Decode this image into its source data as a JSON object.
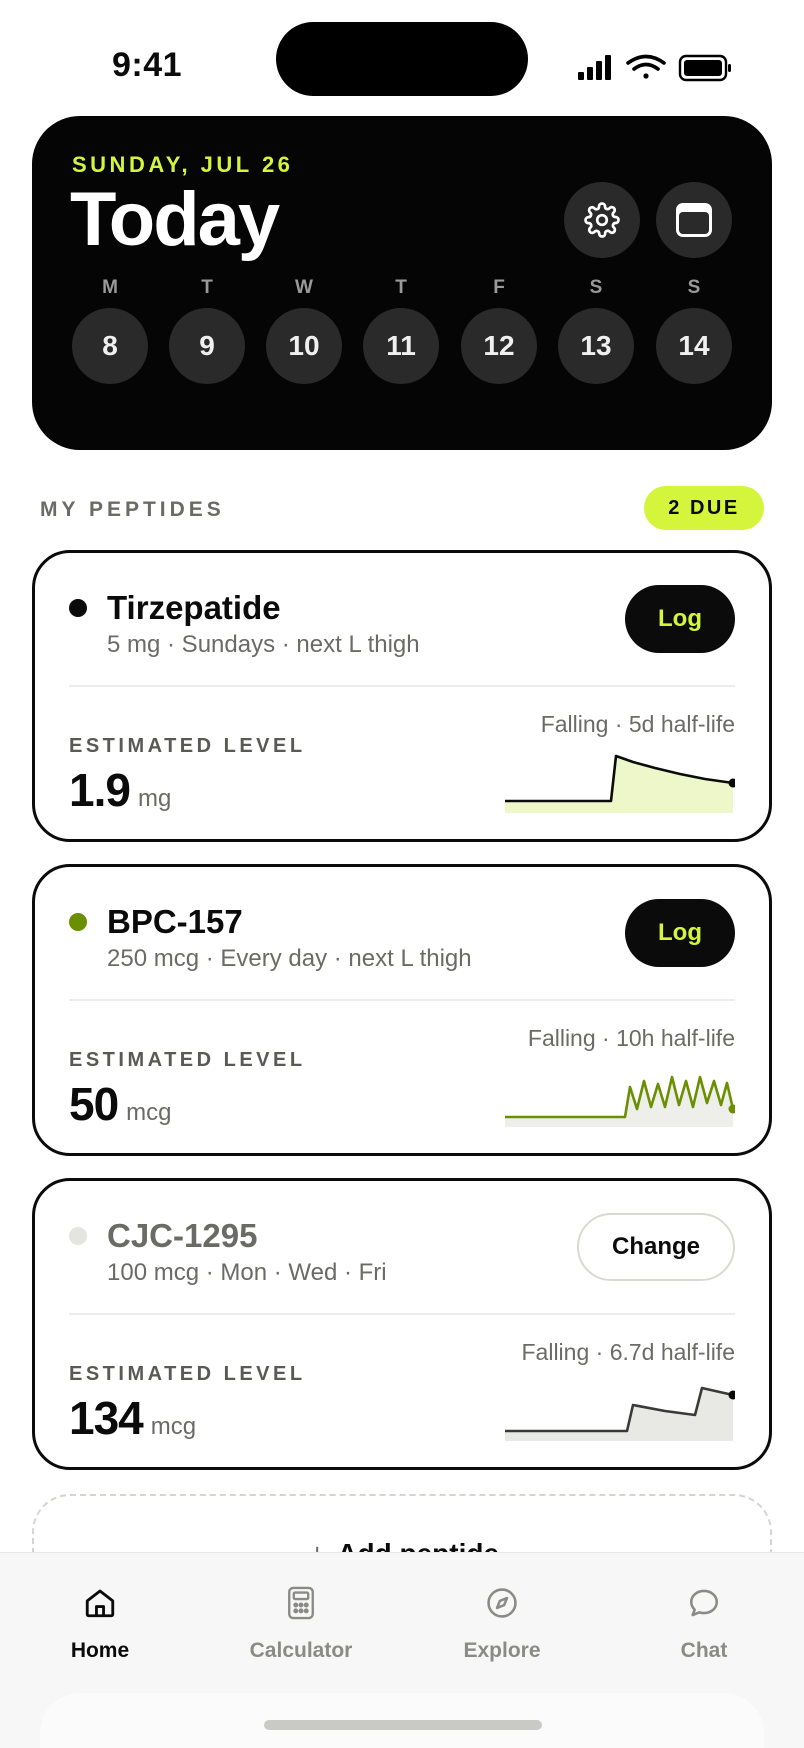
{
  "status_bar": {
    "time": "9:41"
  },
  "hero": {
    "date": "SUNDAY, JUL 26",
    "title": "Today",
    "week": [
      {
        "letter": "M",
        "day": "8"
      },
      {
        "letter": "T",
        "day": "9"
      },
      {
        "letter": "W",
        "day": "10"
      },
      {
        "letter": "T",
        "day": "11"
      },
      {
        "letter": "F",
        "day": "12"
      },
      {
        "letter": "S",
        "day": "13"
      },
      {
        "letter": "S",
        "day": "14"
      }
    ]
  },
  "section": {
    "label": "MY PEPTIDES",
    "due_badge": "2 DUE"
  },
  "colors": {
    "accent": "#d4f53c",
    "dark": "#050505",
    "olive": "#6a8f00"
  },
  "peptides": [
    {
      "name": "Tirzepatide",
      "subtitle": "5 mg · Sundays · next L thigh",
      "action": "Log",
      "level_label": "ESTIMATED LEVEL",
      "level_value": "1.9",
      "level_unit": "mg",
      "trend": "Falling · 5d half-life",
      "dot_color": "#0b0b0b",
      "line_color": "#0b0b0b",
      "fill_color": "#eef7c9"
    },
    {
      "name": "BPC-157",
      "subtitle": "250 mcg · Every day · next L thigh",
      "action": "Log",
      "level_label": "ESTIMATED LEVEL",
      "level_value": "50",
      "level_unit": "mcg",
      "trend": "Falling · 10h half-life",
      "dot_color": "#6a8f00",
      "line_color": "#6a8f00",
      "fill_color": "#eeeeea"
    },
    {
      "name": "CJC-1295",
      "subtitle": "100 mcg · Mon · Wed · Fri",
      "action": "Change",
      "level_label": "ESTIMATED LEVEL",
      "level_value": "134",
      "level_unit": "mcg",
      "trend": "Falling · 6.7d half-life",
      "dot_color": "#e4e4e1",
      "line_color": "#3a3a38",
      "fill_color": "#e8e8e4"
    }
  ],
  "add_peptide": {
    "plus": "+",
    "label": "Add peptide"
  },
  "tabbar": {
    "items": [
      {
        "label": "Home",
        "icon": "home-icon"
      },
      {
        "label": "Calculator",
        "icon": "calculator-icon"
      },
      {
        "label": "Explore",
        "icon": "compass-icon"
      },
      {
        "label": "Chat",
        "icon": "chat-bubble-icon"
      }
    ]
  }
}
